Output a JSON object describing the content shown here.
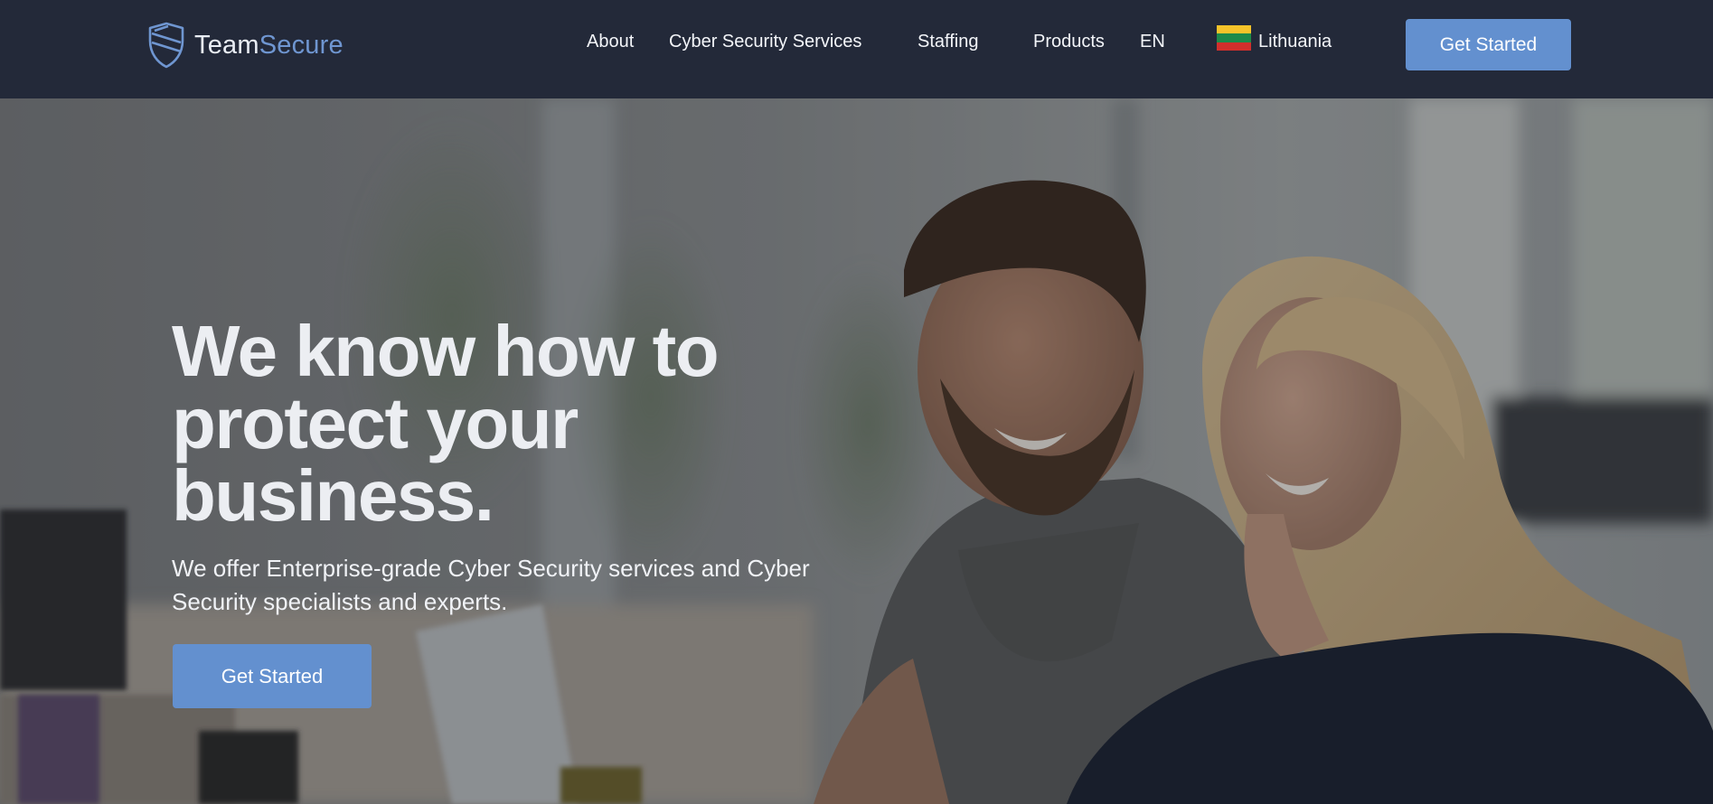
{
  "brand": {
    "name_part1": "Team",
    "name_part2": "Secure",
    "logo_icon": "shield-icon",
    "colors": {
      "team": "#e9edf4",
      "secure": "#6f96d1"
    }
  },
  "nav": {
    "about": "About",
    "cyber_security_services": "Cyber Security Services",
    "staffing": "Staffing",
    "products": "Products",
    "language": "EN",
    "country": "Lithuania",
    "country_flag_icon": "lithuania-flag-icon",
    "cta": "Get Started"
  },
  "hero": {
    "title": "We know how to protect your business.",
    "subtitle": "We offer Enterprise-grade Cyber Security services and Cyber Security specialists and experts.",
    "cta": "Get Started",
    "background_image": "photo of smiling man and woman looking at a laptop in an office"
  },
  "colors": {
    "header_bg": "#232939",
    "accent": "#6390cf",
    "text_light": "#f3f5f9"
  }
}
